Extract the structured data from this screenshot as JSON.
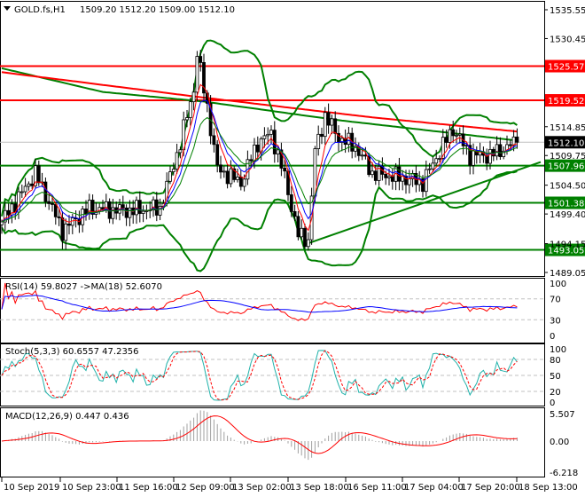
{
  "header": {
    "symbol": "GOLD.fs,H1",
    "ohlc": "1509.20 1512.20 1509.00 1512.10"
  },
  "chart_data": {
    "type": "candlestick",
    "title": "GOLD.fs,H1 1509.20 1512.20 1509.00 1512.10",
    "bars": 154,
    "close_keypoints": [
      [
        0,
        1498
      ],
      [
        10,
        1506.6
      ],
      [
        18,
        1496.5
      ],
      [
        26,
        1500.4
      ],
      [
        37,
        1500
      ],
      [
        47,
        1500.4
      ],
      [
        53,
        1512
      ],
      [
        57,
        1521.6
      ],
      [
        58,
        1527.8
      ],
      [
        61,
        1518.4
      ],
      [
        64,
        1507.4
      ],
      [
        71,
        1505
      ],
      [
        76,
        1512
      ],
      [
        80,
        1513.7
      ],
      [
        84,
        1505.9
      ],
      [
        88,
        1495.7
      ],
      [
        91,
        1494.8
      ],
      [
        93,
        1510.5
      ],
      [
        96,
        1516.8
      ],
      [
        100,
        1512.9
      ],
      [
        105,
        1511.3
      ],
      [
        110,
        1506.6
      ],
      [
        118,
        1505.9
      ],
      [
        125,
        1505
      ],
      [
        130,
        1510.5
      ],
      [
        134,
        1514.5
      ],
      [
        139,
        1509.8
      ],
      [
        145,
        1509.8
      ],
      [
        153,
        1512.1
      ]
    ],
    "last_price": "1512.10",
    "ylim": [
      1489.05,
      1535.55
    ],
    "price_ticks": [
      "1535.55",
      "1530.45",
      "1514.85",
      "1509.75",
      "1504.50",
      "1499.40",
      "1494.15",
      "1489.05"
    ],
    "levels": [
      {
        "value": "1525.57",
        "color": "#ff0000"
      },
      {
        "value": "1519.52",
        "color": "#ff0000"
      },
      {
        "value": "1507.96",
        "color": "#008000"
      },
      {
        "value": "1501.38",
        "color": "#008000"
      },
      {
        "value": "1493.05",
        "color": "#008000"
      }
    ],
    "trendline": [
      [
        90,
        1494
      ],
      [
        160,
        1508.6
      ]
    ],
    "slow_ma_red": [
      [
        0,
        1524.5
      ],
      [
        60,
        1520
      ],
      [
        110,
        1516.5
      ],
      [
        153,
        1514
      ]
    ],
    "slow_ma_green": [
      [
        0,
        1525.2
      ],
      [
        30,
        1521
      ],
      [
        60,
        1519.3
      ],
      [
        100,
        1516
      ],
      [
        153,
        1512.4
      ]
    ],
    "x_labels": [
      "10 Sep 2019",
      "10 Sep 23:00",
      "11 Sep 16:00",
      "12 Sep 09:00",
      "13 Sep 02:00",
      "13 Sep 18:00",
      "16 Sep 11:00",
      "17 Sep 04:00",
      "17 Sep 20:00",
      "18 Sep 13:00"
    ],
    "rsi": {
      "label": "RSI(14) 59.8027  ->MA(18) 52.6070",
      "ticks": [
        "100",
        "70",
        "30",
        "0"
      ]
    },
    "stoch": {
      "label": "Stoch(5,3,3) 60.6557 47.2356",
      "ticks": [
        "100",
        "80",
        "50",
        "20",
        "0"
      ]
    },
    "macd": {
      "label": "MACD(12,26,9) 0.447 0.436",
      "ticks": [
        "5.507",
        "0.00",
        "-6.218"
      ],
      "range": [
        -6.218,
        5.507
      ]
    },
    "colors": {
      "bull": "#000000",
      "bear": "#000000",
      "bb": "#008000",
      "fast_ma": "#ff0000",
      "mid_ma": "#0000ff",
      "stoch_main": "#20b2aa",
      "stoch_signal": "#ff0000"
    }
  }
}
